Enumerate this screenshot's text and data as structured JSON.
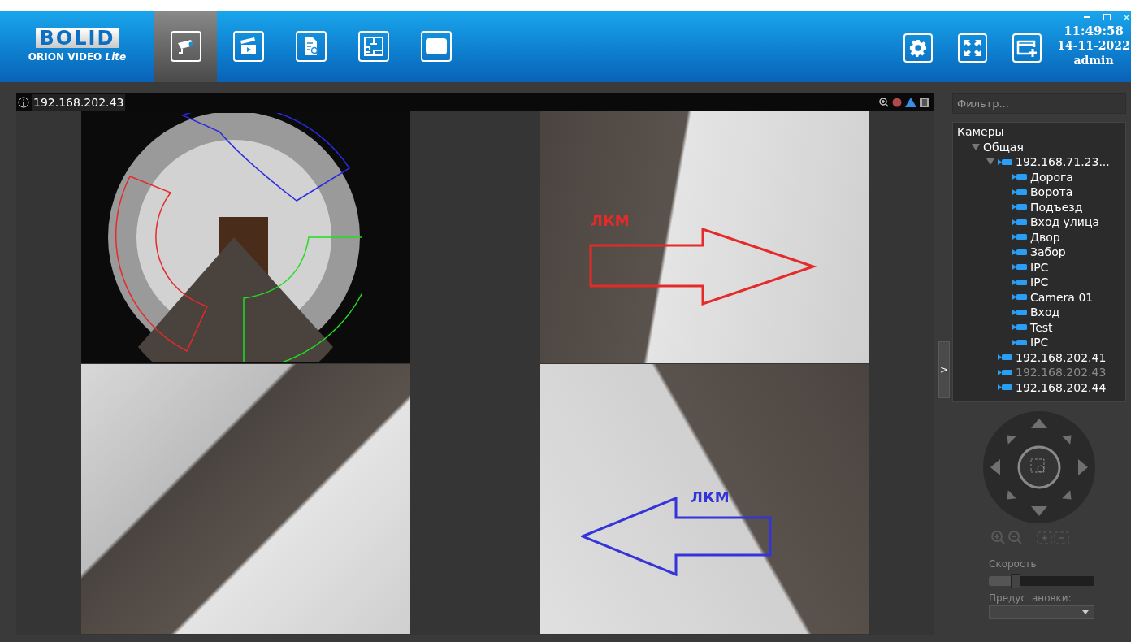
{
  "header": {
    "logo": {
      "brand": "BOLID",
      "product": "ORION VIDEO",
      "edition": "Lite"
    },
    "nav_tabs": [
      {
        "kind": "cameras",
        "selected": true
      },
      {
        "kind": "archive",
        "selected": false
      },
      {
        "kind": "events",
        "selected": false
      },
      {
        "kind": "plan",
        "selected": false
      },
      {
        "kind": "screen",
        "selected": false
      }
    ],
    "tools": [
      {
        "kind": "settings"
      },
      {
        "kind": "fullscreen"
      },
      {
        "kind": "add-window"
      }
    ],
    "clock": "11:49:58",
    "date": "14-11-2022",
    "user": "admin"
  },
  "video": {
    "info_label": "192.168.202.43",
    "tiles": [
      {
        "kind": "fisheye"
      },
      {
        "kind": "view",
        "annotation": {
          "kind": "arrow-right",
          "label": "ЛКМ",
          "color": "#e52a2a"
        }
      },
      {
        "kind": "view"
      },
      {
        "kind": "view",
        "annotation": {
          "kind": "arrow-left",
          "label": "ЛКМ",
          "color": "#3434d8"
        }
      }
    ]
  },
  "panel_toggle": ">",
  "sidebar": {
    "filter": {
      "placeholder": "Фильтр..."
    },
    "tree": [
      {
        "label": "Камеры",
        "kind": "root",
        "children": [
          {
            "label": "Общая",
            "kind": "group",
            "expanded": true,
            "children": [
              {
                "label": "192.168.71.23...",
                "kind": "camera",
                "expanded": true,
                "children": [
                  {
                    "label": "Дорога",
                    "kind": "camera",
                    "disabled": false
                  },
                  {
                    "label": "Ворота",
                    "kind": "camera",
                    "disabled": false
                  },
                  {
                    "label": "Подъезд",
                    "kind": "camera",
                    "disabled": false
                  },
                  {
                    "label": "Вход улица",
                    "kind": "camera",
                    "disabled": false
                  },
                  {
                    "label": "Двор",
                    "kind": "camera",
                    "disabled": false
                  },
                  {
                    "label": "Забор",
                    "kind": "camera",
                    "disabled": false
                  },
                  {
                    "label": "IPC",
                    "kind": "camera",
                    "disabled": false
                  },
                  {
                    "label": "IPC",
                    "kind": "camera",
                    "disabled": false
                  },
                  {
                    "label": "Camera 01",
                    "kind": "camera",
                    "disabled": false
                  },
                  {
                    "label": "Вход",
                    "kind": "camera",
                    "disabled": false
                  },
                  {
                    "label": "Test",
                    "kind": "camera",
                    "disabled": false
                  },
                  {
                    "label": "IPC",
                    "kind": "camera",
                    "disabled": false
                  }
                ]
              },
              {
                "label": "192.168.202.41",
                "kind": "camera",
                "disabled": false
              },
              {
                "label": "192.168.202.43",
                "kind": "camera",
                "disabled": true
              },
              {
                "label": "192.168.202.44",
                "kind": "camera",
                "disabled": false
              }
            ]
          }
        ]
      }
    ],
    "speed": {
      "label": "Скорость",
      "level": 0.25
    },
    "presets": {
      "label": "Предустановки:"
    }
  }
}
